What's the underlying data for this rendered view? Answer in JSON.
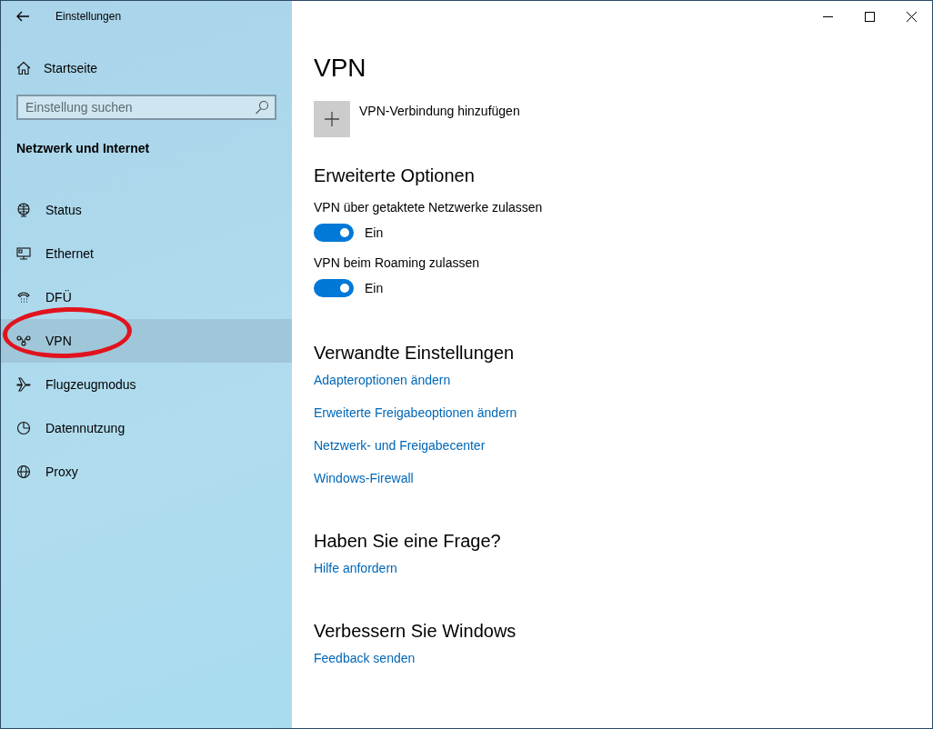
{
  "window": {
    "title": "Einstellungen"
  },
  "sidebar": {
    "home": "Startseite",
    "search": {
      "placeholder": "Einstellung suchen"
    },
    "category": "Netzwerk und Internet",
    "items": [
      {
        "kind": "status",
        "label": "Status",
        "selected": false
      },
      {
        "kind": "ethernet",
        "label": "Ethernet",
        "selected": false
      },
      {
        "kind": "dialup",
        "label": "DFÜ",
        "selected": false
      },
      {
        "kind": "vpn",
        "label": "VPN",
        "selected": true
      },
      {
        "kind": "airplane",
        "label": "Flugzeugmodus",
        "selected": false
      },
      {
        "kind": "data",
        "label": "Datennutzung",
        "selected": false
      },
      {
        "kind": "proxy",
        "label": "Proxy",
        "selected": false
      }
    ]
  },
  "main": {
    "title": "VPN",
    "add_connection": "VPN-Verbindung hinzufügen",
    "advanced": {
      "heading": "Erweiterte Optionen",
      "toggles": [
        {
          "label": "VPN über getaktete Netzwerke zulassen",
          "on": true,
          "state_text": "Ein"
        },
        {
          "label": "VPN beim Roaming zulassen",
          "on": true,
          "state_text": "Ein"
        }
      ]
    },
    "sections": [
      {
        "heading": "Verwandte Einstellungen",
        "links": [
          "Adapteroptionen ändern",
          "Erweiterte Freigabeoptionen ändern",
          "Netzwerk- und Freigabecenter",
          "Windows-Firewall"
        ]
      },
      {
        "heading": "Haben Sie eine Frage?",
        "links": [
          "Hilfe anfordern"
        ]
      },
      {
        "heading": "Verbessern Sie Windows",
        "links": [
          "Feedback senden"
        ]
      }
    ]
  }
}
